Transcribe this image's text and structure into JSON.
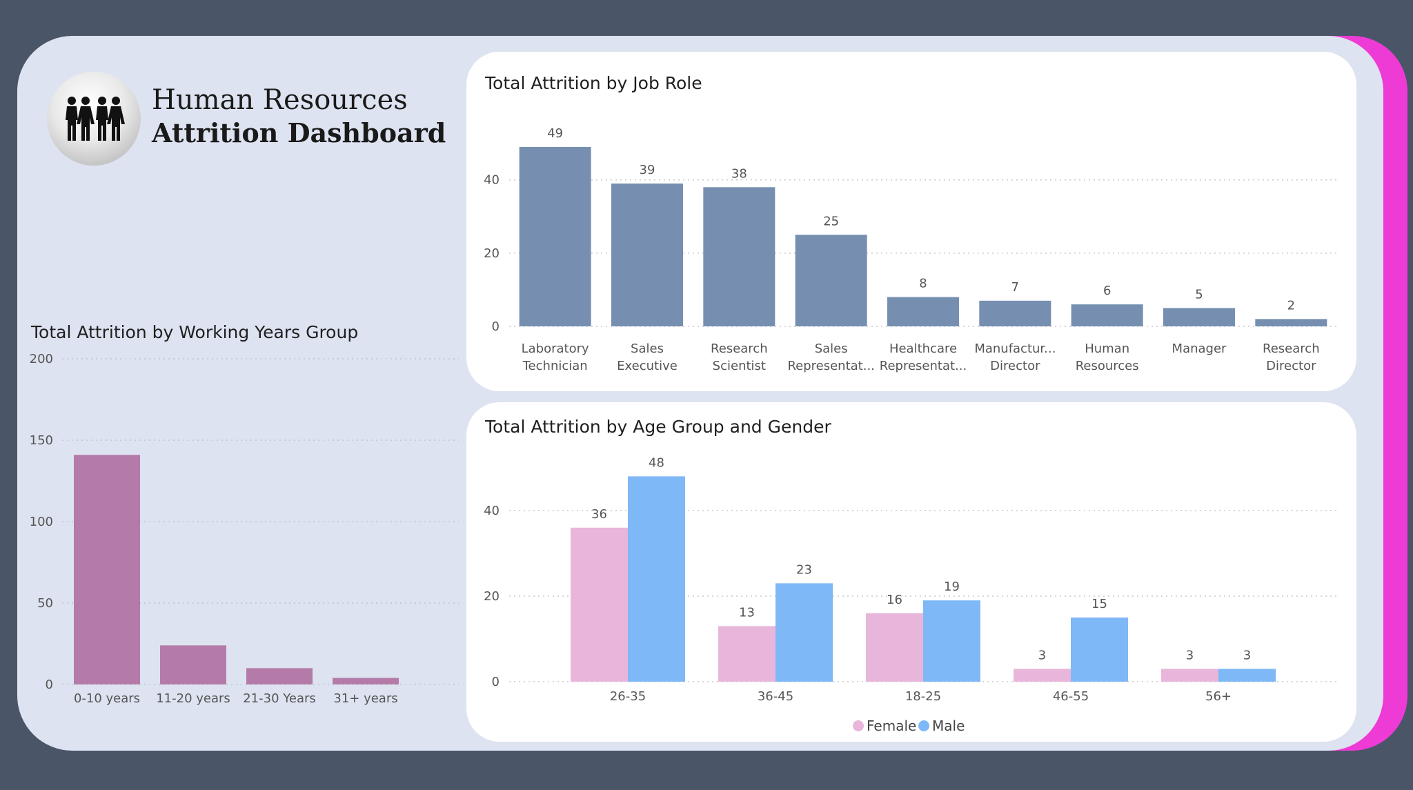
{
  "header": {
    "title_line1": "Human Resources",
    "title_line2": "Attrition Dashboard",
    "logo_icon": "people-group-icon"
  },
  "colors": {
    "background": "#4a5568",
    "panel": "#dde3f0",
    "accent": "#ee3bd5",
    "job_role_bar": "#768fb0",
    "working_years_bar": "#b47ba9",
    "female": "#e8b6da",
    "male": "#7eb8f7"
  },
  "chart_data": [
    {
      "id": "job_role",
      "type": "bar",
      "title": "Total Attrition by Job Role",
      "categories": [
        [
          "Laboratory",
          "Technician"
        ],
        [
          "Sales",
          "Executive"
        ],
        [
          "Research",
          "Scientist"
        ],
        [
          "Sales",
          "Representat..."
        ],
        [
          "Healthcare",
          "Representat..."
        ],
        [
          "Manufactur...",
          "Director"
        ],
        [
          "Human",
          "Resources"
        ],
        [
          "Manager"
        ],
        [
          "Research",
          "Director"
        ]
      ],
      "values": [
        49,
        39,
        38,
        25,
        8,
        7,
        6,
        5,
        2
      ],
      "yticks": [
        0,
        20,
        40
      ],
      "ylim": [
        0,
        52
      ],
      "grid": true
    },
    {
      "id": "working_years",
      "type": "bar",
      "title": "Total Attrition by Working Years Group",
      "categories": [
        "0-10 years",
        "11-20 years",
        "21-30 Years",
        "31+ years"
      ],
      "values": [
        141,
        24,
        10,
        4
      ],
      "yticks": [
        0,
        50,
        100,
        150,
        200
      ],
      "ylim": [
        0,
        200
      ],
      "grid": true
    },
    {
      "id": "age_gender",
      "type": "bar",
      "title": "Total Attrition by Age Group and Gender",
      "categories": [
        "26-35",
        "36-45",
        "18-25",
        "46-55",
        "56+"
      ],
      "series": [
        {
          "name": "Female",
          "values": [
            36,
            13,
            16,
            3,
            3
          ]
        },
        {
          "name": "Male",
          "values": [
            48,
            23,
            19,
            15,
            3
          ]
        }
      ],
      "yticks": [
        0,
        20,
        40
      ],
      "ylim": [
        0,
        50
      ],
      "grid": true,
      "legend": "bottom-center"
    }
  ]
}
